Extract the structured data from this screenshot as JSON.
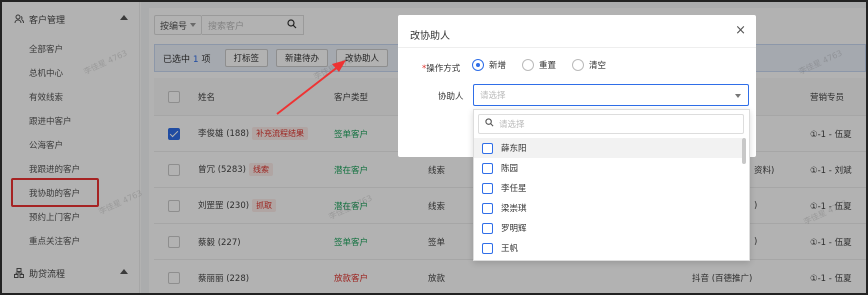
{
  "sidebar": {
    "section1": {
      "title": "客户管理"
    },
    "items": [
      {
        "label": "全部客户"
      },
      {
        "label": "总机中心"
      },
      {
        "label": "有效线索"
      },
      {
        "label": "跟进中客户"
      },
      {
        "label": "公海客户"
      },
      {
        "label": "我跟进的客户"
      },
      {
        "label": "我协助的客户"
      },
      {
        "label": "预约上门客户"
      },
      {
        "label": "重点关注客户"
      }
    ],
    "section2": {
      "title": "助贷流程"
    }
  },
  "toolbar": {
    "filter_select": "按编号",
    "search_placeholder": "搜索客户"
  },
  "selection_bar": {
    "prefix": "已选中",
    "count": "1",
    "suffix": "项",
    "buttons": [
      "打标签",
      "新建待办",
      "改协助人"
    ]
  },
  "table": {
    "headers": {
      "name": "姓名",
      "type": "客户类型",
      "owner": "营销专员"
    },
    "rows": [
      {
        "name": "李俊雄 (188)",
        "tag": "补充流程结果",
        "type": "签单客户",
        "type_color": "green",
        "source": "",
        "channel": "",
        "owner": "①-1 - 伍夏",
        "checked": true
      },
      {
        "name": "曾冗 (5283)",
        "tag": "线索",
        "type": "潜在客户",
        "type_color": "green",
        "source": "线索",
        "channel": "资料)",
        "owner": "①-1 - 刘斌",
        "checked": false
      },
      {
        "name": "刘罡罡 (230)",
        "tag": "抓取",
        "type": "潜在客户",
        "type_color": "green",
        "source": "线索",
        "channel": ")",
        "owner": "①-1 - 伍夏",
        "checked": false
      },
      {
        "name": "蔡毅 (227)",
        "tag": "",
        "type": "签单客户",
        "type_color": "green",
        "source": "签单",
        "channel": ")",
        "owner": "①-1 - 伍夏",
        "checked": false
      },
      {
        "name": "蔡丽丽 (228)",
        "tag": "",
        "type": "放款客户",
        "type_color": "red",
        "source": "放款",
        "channel": "抖音 (百德推广)",
        "owner": "①-1 - 伍夏",
        "checked": false
      }
    ]
  },
  "modal": {
    "title": "改协助人",
    "close": "×",
    "op_label": "操作方式",
    "op_required": "*",
    "options": [
      "新增",
      "重置",
      "清空"
    ],
    "selected_option": 0,
    "assist_label": "协助人",
    "assist_placeholder": "请选择"
  },
  "dropdown": {
    "search_placeholder": "请选择",
    "options": [
      "薛东阳",
      "陈园",
      "李任星",
      "梁崇琪",
      "罗明辉",
      "王帆"
    ]
  },
  "watermark": "李佳星 4763",
  "colors": {
    "accent": "#2f6ee8",
    "danger": "#e0322b",
    "success": "#19a35b"
  }
}
